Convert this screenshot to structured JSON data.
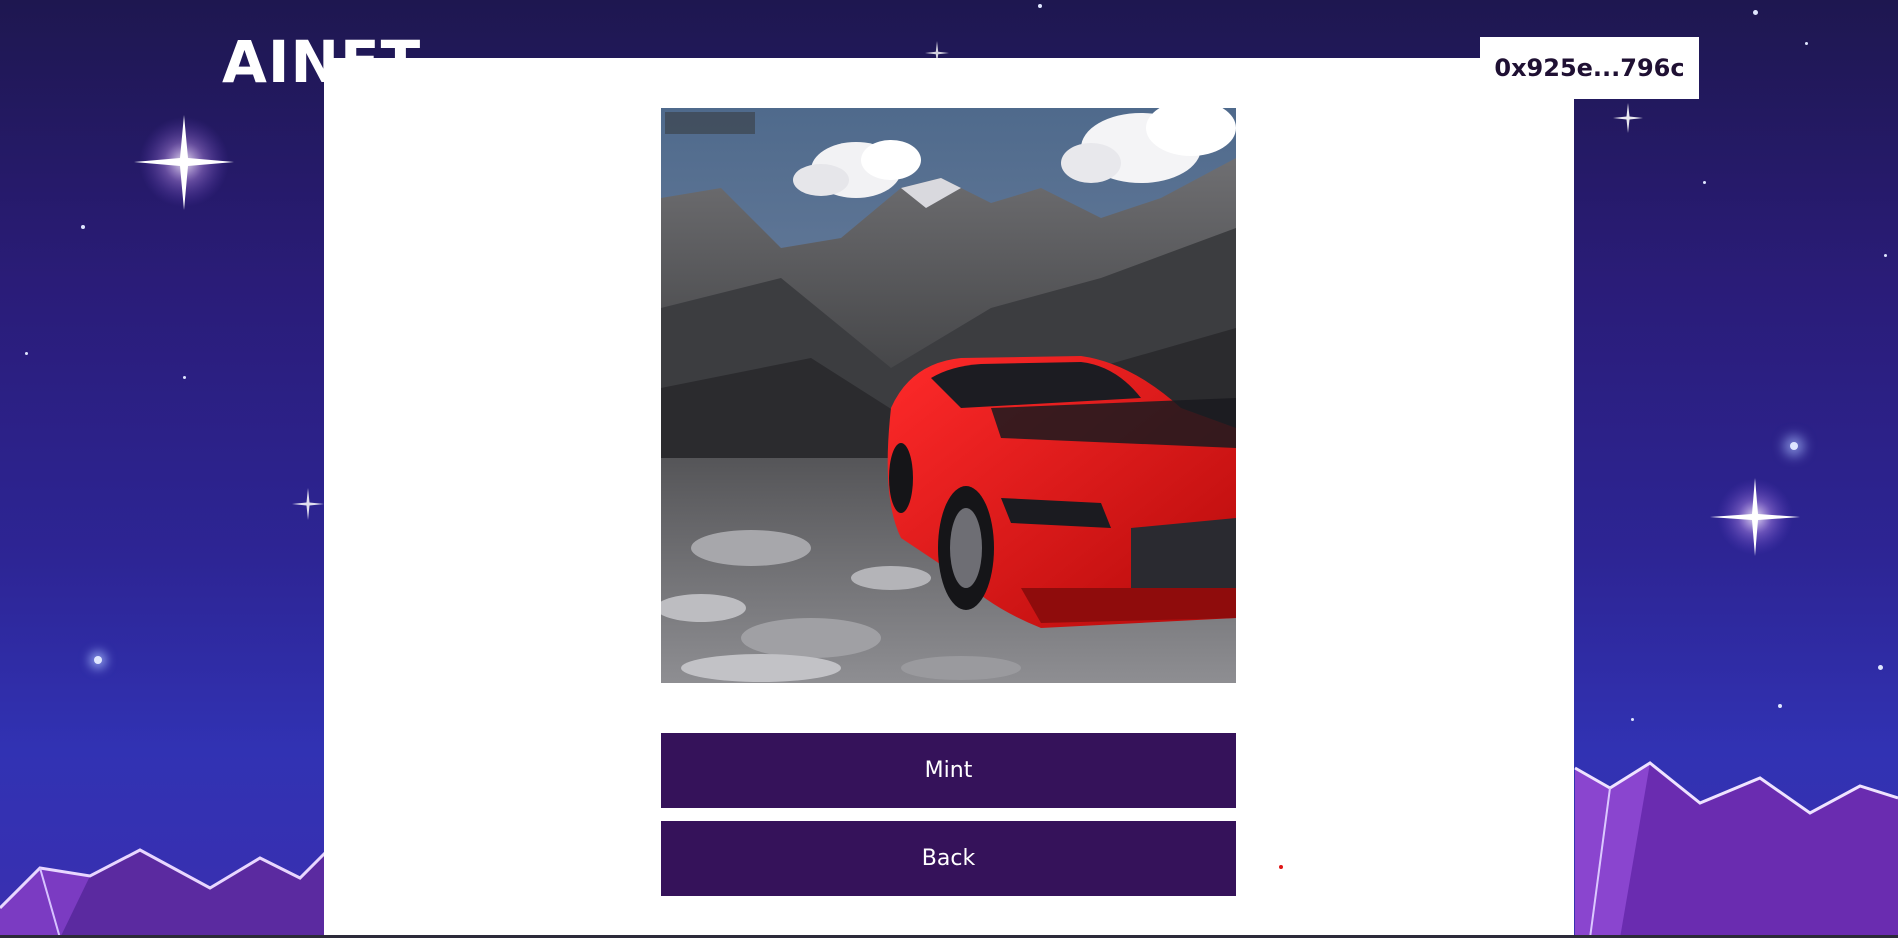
{
  "header": {
    "brand": "AINFT",
    "wallet_address": "0x925e...796c"
  },
  "modal": {
    "image_alt": "Generated artwork: red sports car on rocky mountain terrain",
    "mint_label": "Mint",
    "back_label": "Back"
  },
  "colors": {
    "button_bg": "#35125a",
    "background_top": "#1e1750",
    "background_bottom": "#3132b3",
    "accent_red": "#e01515"
  }
}
